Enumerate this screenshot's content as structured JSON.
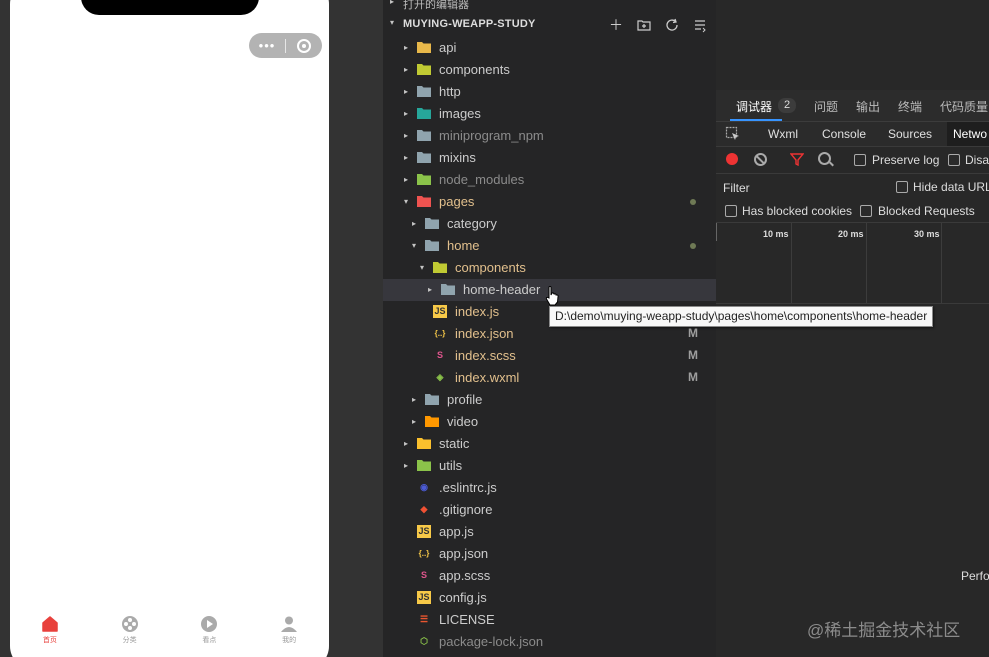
{
  "simulator": {
    "capsule": {
      "more_icon": "more-dots-icon",
      "close_icon": "target-circle-icon"
    },
    "tabbar": [
      {
        "label": "首页",
        "icon": "home-icon",
        "active": true
      },
      {
        "label": "分类",
        "icon": "category-icon",
        "active": false
      },
      {
        "label": "看点",
        "icon": "play-icon",
        "active": false
      },
      {
        "label": "我的",
        "icon": "user-icon",
        "active": false
      }
    ]
  },
  "explorer": {
    "opened_editors": "打开的编辑器",
    "project_title": "MUYING-WEAPP-STUDY",
    "actions": [
      "new-file-icon",
      "new-folder-icon",
      "refresh-icon",
      "collapse-icon"
    ],
    "tree": [
      {
        "name": "api",
        "kind": "folder",
        "color": "#e8b84a",
        "arrow": "▸"
      },
      {
        "name": "components",
        "kind": "folder",
        "color": "#c0ca33",
        "arrow": "▸"
      },
      {
        "name": "http",
        "kind": "folder",
        "color": "#90a4ae",
        "arrow": "▸"
      },
      {
        "name": "images",
        "kind": "folder",
        "color": "#26a69a",
        "arrow": "▸"
      },
      {
        "name": "miniprogram_npm",
        "kind": "folder",
        "color": "#90a4ae",
        "arrow": "▸",
        "dim": true
      },
      {
        "name": "mixins",
        "kind": "folder",
        "color": "#90a4ae",
        "arrow": "▸"
      },
      {
        "name": "node_modules",
        "kind": "folder",
        "color": "#8bc34a",
        "arrow": "▸",
        "dim": true
      },
      {
        "name": "pages",
        "kind": "folder",
        "color": "#ef5350",
        "arrow": "▾",
        "dot": true,
        "highlight": "#e2c08d"
      },
      {
        "name": "category",
        "kind": "folder",
        "color": "#90a4ae",
        "arrow": "▸",
        "depth": 1
      },
      {
        "name": "home",
        "kind": "folder",
        "color": "#90a4ae",
        "arrow": "▾",
        "depth": 1,
        "dot": true,
        "highlight": "#e2c08d"
      },
      {
        "name": "components",
        "kind": "folder",
        "color": "#c0ca33",
        "arrow": "▾",
        "depth": 2,
        "highlight": "#e2c08d"
      },
      {
        "name": "home-header",
        "kind": "folder",
        "color": "#90a4ae",
        "arrow": "▸",
        "depth": 3,
        "selected": true
      },
      {
        "name": "index.js",
        "kind": "js",
        "depth": 2,
        "highlight": "#e2c08d"
      },
      {
        "name": "index.json",
        "kind": "json",
        "depth": 2,
        "badge": "M",
        "highlight": "#e2c08d"
      },
      {
        "name": "index.scss",
        "kind": "scss",
        "depth": 2,
        "badge": "M",
        "highlight": "#e2c08d"
      },
      {
        "name": "index.wxml",
        "kind": "wxml",
        "depth": 2,
        "badge": "M",
        "highlight": "#e2c08d"
      },
      {
        "name": "profile",
        "kind": "folder",
        "color": "#90a4ae",
        "arrow": "▸",
        "depth": 1
      },
      {
        "name": "video",
        "kind": "folder",
        "color": "#ff9800",
        "arrow": "▸",
        "depth": 1
      },
      {
        "name": "static",
        "kind": "folder",
        "color": "#fbc02d",
        "arrow": "▸"
      },
      {
        "name": "utils",
        "kind": "folder",
        "color": "#8bc34a",
        "arrow": "▸"
      },
      {
        "name": ".eslintrc.js",
        "kind": "eslint"
      },
      {
        "name": ".gitignore",
        "kind": "git"
      },
      {
        "name": "app.js",
        "kind": "js"
      },
      {
        "name": "app.json",
        "kind": "json"
      },
      {
        "name": "app.scss",
        "kind": "scss"
      },
      {
        "name": "config.js",
        "kind": "js"
      },
      {
        "name": "LICENSE",
        "kind": "license"
      },
      {
        "name": "package-lock.json",
        "kind": "npm",
        "dim": true
      }
    ]
  },
  "devtools": {
    "top_tabs": [
      "调试器",
      "问题",
      "输出",
      "终端",
      "代码质量"
    ],
    "debugger_count": "2",
    "panel_tabs": [
      "Wxml",
      "Console",
      "Sources",
      "Netwo"
    ],
    "inspect_icon": "inspect-icon",
    "preserve_log": "Preserve log",
    "disable_cache": "Disa",
    "filter_label": "Filter",
    "hide_data_urls": "Hide data URL",
    "has_blocked_cookies": "Has blocked cookies",
    "blocked_requests": "Blocked Requests",
    "timeline_ticks": [
      "10 ms",
      "20 ms",
      "30 ms"
    ],
    "perf_label": "Perfo"
  },
  "tooltip": "D:\\demo\\muying-weapp-study\\pages\\home\\components\\home-header",
  "watermark": "@稀土掘金技术社区"
}
